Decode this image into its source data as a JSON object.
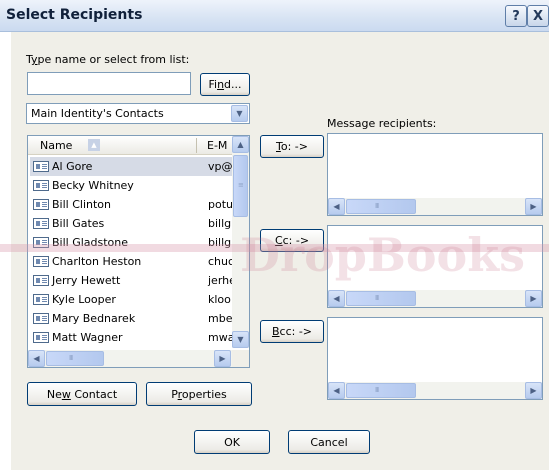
{
  "window": {
    "title": "Select Recipients",
    "help_glyph": "?",
    "close_glyph": "X"
  },
  "search": {
    "label_pre": "T",
    "label_u": "y",
    "label_post": "pe name or select from list:",
    "value": "",
    "find_pre": "Fi",
    "find_u": "n",
    "find_post": "d..."
  },
  "address_book": {
    "selected": "Main Identity's Contacts"
  },
  "contacts": {
    "columns": {
      "name": "Name",
      "email": "E-M"
    },
    "rows": [
      {
        "name": "Al Gore",
        "email": "vp@",
        "selected": true
      },
      {
        "name": "Becky Whitney",
        "email": ""
      },
      {
        "name": "Bill Clinton",
        "email": "potu"
      },
      {
        "name": "Bill Gates",
        "email": "billg("
      },
      {
        "name": "Bill Gladstone",
        "email": "billg("
      },
      {
        "name": "Charlton Heston",
        "email": "chuc"
      },
      {
        "name": "Jerry Hewett",
        "email": "jerhe"
      },
      {
        "name": "Kyle Looper",
        "email": "kloo"
      },
      {
        "name": "Mary Bednarek",
        "email": "mbe"
      },
      {
        "name": "Matt Wagner",
        "email": "mwa"
      }
    ]
  },
  "recipients": {
    "label": "Message recipients:",
    "to_u": "T",
    "to_post": "o: ->",
    "cc_u": "C",
    "cc_post": "c: ->",
    "bcc_u": "B",
    "bcc_post": "cc: ->"
  },
  "buttons": {
    "new_contact_pre": "Ne",
    "new_contact_u": "w",
    "new_contact_post": " Contact",
    "properties_pre": "P",
    "properties_u": "r",
    "properties_post": "operties",
    "ok": "OK",
    "cancel": "Cancel"
  },
  "watermark_text": "DropBooks",
  "colors": {
    "accent": "#003c74",
    "selection": "#d6dbe6"
  }
}
